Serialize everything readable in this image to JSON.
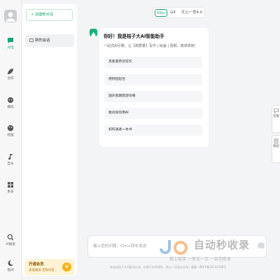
{
  "rail": {
    "items": [
      {
        "label": "对话",
        "icon": "chat-icon",
        "active": true
      },
      {
        "label": "创作",
        "icon": "feather-icon"
      },
      {
        "label": "模拟",
        "icon": "mask-icon"
      },
      {
        "label": "绘画",
        "icon": "palette-icon"
      },
      {
        "label": "音乐",
        "icon": "music-icon"
      },
      {
        "label": "更多",
        "icon": "grid-icon"
      }
    ],
    "ai_search": "AI搜索",
    "theme": "夜间"
  },
  "sidebar": {
    "new_chat": "+ 创建新对话",
    "conversations": [
      {
        "label": "新的会话"
      }
    ],
    "vip": {
      "title": "开通会员",
      "subtitle": "高速通道 无限对话",
      "badge": "V"
    }
  },
  "tabs": [
    {
      "label": "Kimi",
      "active": true
    },
    {
      "label": "G4"
    },
    {
      "label": "文心一言4.0"
    }
  ],
  "welcome": {
    "title": "你好！我是桔子大AI智能助手",
    "subtitle": "一站式AI引擎，让【高质量】写作 | 绘画 | 视频，简单高效！",
    "suggestions": [
      "高质量原创写作",
      "用例铅起名",
      "国庆假期旅游攻略",
      "数间如何用AI",
      "如何通透一本书"
    ]
  },
  "right_float": [
    {
      "label": "客服",
      "icon": "chat-bubble-icon"
    },
    {
      "label": "教程",
      "icon": "document-icon"
    }
  ],
  "input": {
    "placeholder": "输入您的问题，Ctrl+回车发送"
  },
  "footer": "本站由桔子大AI驱动生成，仅限于技术研究，禁止一切违法活动 / 谨慎 / 粤ICP备18102398号",
  "watermark": {
    "title": "自动秒收录",
    "subtitle": "做上链接 一来访一次 一自动收录"
  },
  "colors": {
    "accent": "#17a673",
    "vip_bg": "#fff3d6"
  }
}
